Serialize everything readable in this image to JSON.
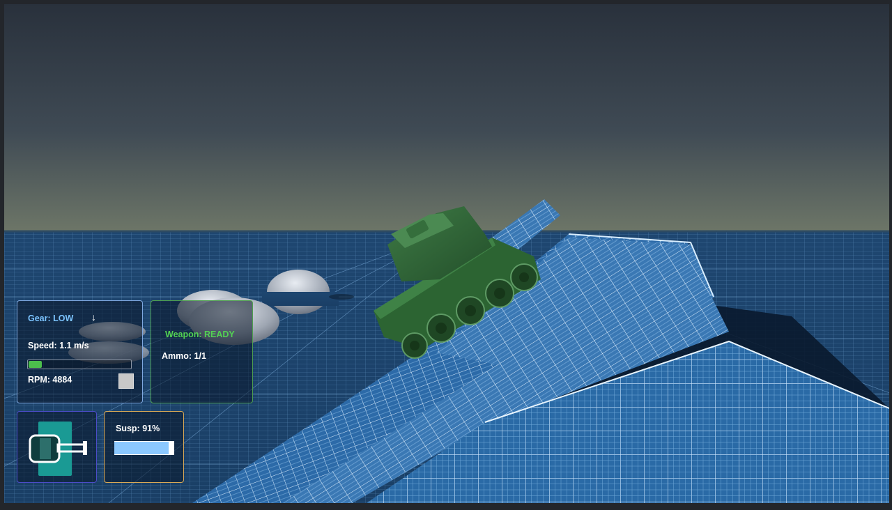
{
  "hud": {
    "gear": {
      "label": "Gear: LOW",
      "arrow_icon": "arrow-down-icon"
    },
    "speed": {
      "label": "Speed: 1.1 m/s"
    },
    "rpm": {
      "label": "RPM: 4884",
      "bar_fraction": 0.13,
      "bar_color": "#4cbf4c"
    },
    "weapon": {
      "label": "Weapon: READY",
      "color": "#53d153"
    },
    "ammo": {
      "label": "Ammo: 1/1"
    },
    "suspension": {
      "label": "Susp: 91%",
      "value": 0.91,
      "bar_color": "#8bc8ff"
    },
    "tank_icon": {
      "icon": "tank-silhouette-icon",
      "hull_color": "#1a9a94"
    }
  },
  "scene": {
    "sky_top": "#2b3440",
    "sky_horizon": "#6c7466",
    "ground_color": "#21507f",
    "grid_color": "#9fd3ff",
    "tank_color": "#2f6a35"
  }
}
